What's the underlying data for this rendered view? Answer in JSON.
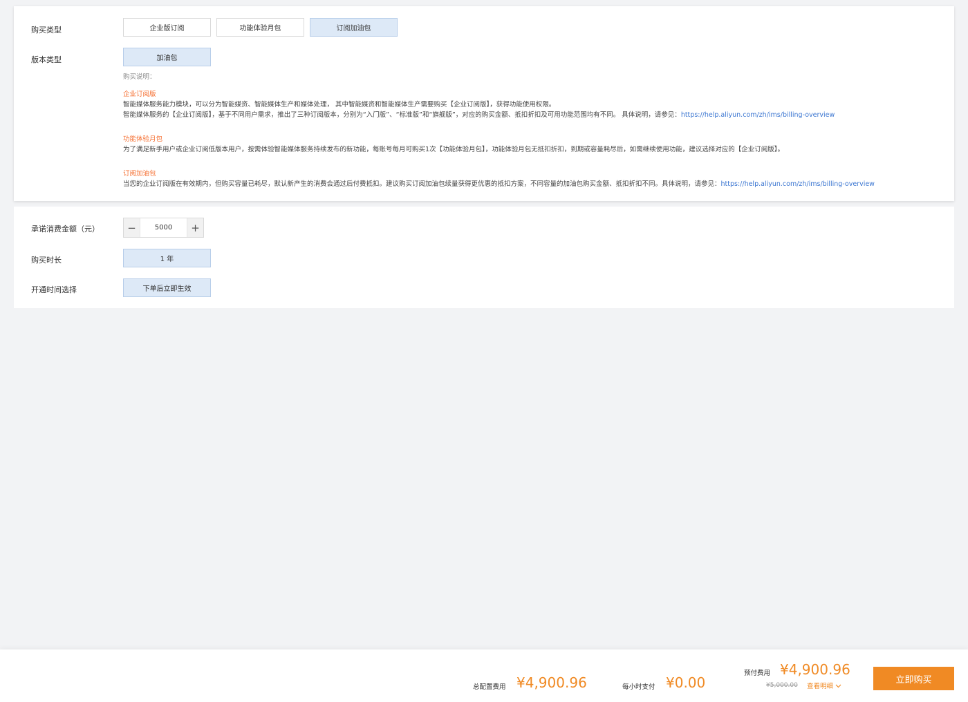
{
  "section1": {
    "purchase_type_label": "购买类型",
    "purchase_types": [
      "企业版订阅",
      "功能体验月包",
      "订阅加油包"
    ],
    "selected_purchase_type": "订阅加油包",
    "edition_type_label": "版本类型",
    "edition_option": "加油包",
    "desc_header": "购买说明：",
    "desc": {
      "enterprise": {
        "title": "企业订阅版",
        "line1": "智能媒体服务能力模块，可以分为智能媒资、智能媒体生产和媒体处理， 其中智能媒资和智能媒体生产需要购买【企业订阅版】，获得功能使用权限。",
        "line2": "智能媒体服务的【企业订阅版】，基于不同用户需求，推出了三种订阅版本，分别为“入门版”、“标准版”和“旗舰版”，对应的购买金额、抵扣折扣及可用功能范围均有不同。 具体说明，请参见：",
        "link": "https://help.aliyun.com/zh/ims/billing-overview"
      },
      "trial": {
        "title": "功能体验月包",
        "line1": "为了满足新手用户或企业订阅低版本用户，按需体验智能媒体服务持续发布的新功能，每账号每月可购买1次【功能体验月包】，功能体验月包无抵扣折扣，到期或容量耗尽后，如需继续使用功能，建议选择对应的【企业订阅版】。"
      },
      "addon": {
        "title": "订阅加油包",
        "line1": "当您的企业订阅版在有效期内，但购买容量已耗尽，默认新产生的消费会通过后付费抵扣。建议购买订阅加油包续量获得更优惠的抵扣方案，不同容量的加油包购买金额、抵扣折扣不同。具体说明，请参见：",
        "link": "https://help.aliyun.com/zh/ims/billing-overview"
      }
    }
  },
  "section2": {
    "amount_label": "承诺消费金额（元）",
    "amount_value": "5000",
    "minus": "−",
    "plus": "+",
    "duration_label": "购买时长",
    "duration_value": "1 年",
    "activation_label": "开通时间选择",
    "activation_value": "下单后立即生效"
  },
  "footer": {
    "total_label": "总配置费用",
    "total_price": "¥4,900.96",
    "hourly_label": "每小时支付",
    "hourly_price": "¥0.00",
    "prepay_label": "预付费用",
    "prepay_price": "¥4,900.96",
    "original_price": "¥5,000.00",
    "detail_label": "查看明细",
    "buy_label": "立即购买"
  },
  "colors": {
    "accent": "#f08a24",
    "selected_bg": "#dde9f7",
    "link": "#3b76d1",
    "desc_title": "#f56c2d"
  }
}
